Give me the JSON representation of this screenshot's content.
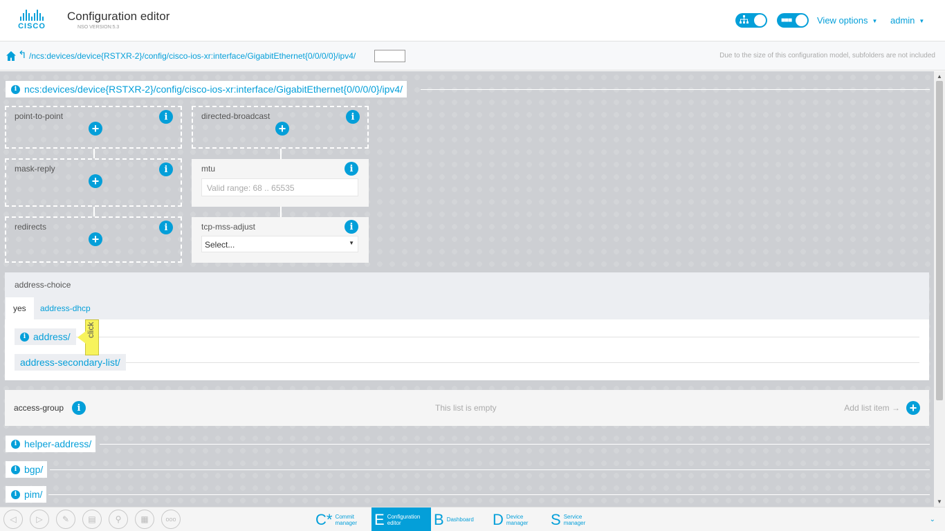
{
  "app": {
    "logo_text": "CISCO",
    "title": "Configuration editor",
    "version": "NSO VERSION:5.3",
    "view_options": "View options",
    "user": "admin"
  },
  "pathbar": {
    "path": "/ncs:devices/device{RSTXR-2}/config/cisco-ios-xr:interface/GigabitEthernet{0/0/0/0}/ipv4/",
    "input_value": "",
    "note": "Due to the size of this configuration model, subfolders are not included"
  },
  "workspace": {
    "top_crumb": "ncs:devices/device{RSTXR-2}/config/cisco-ios-xr:interface/GigabitEthernet{0/0/0/0}/ipv4/",
    "nodes": {
      "point_to_point": "point-to-point",
      "directed_broadcast": "directed-broadcast",
      "mask_reply": "mask-reply",
      "redirects": "redirects",
      "mtu": "mtu",
      "mtu_placeholder": "Valid range: 68 .. 65535",
      "tcp_mss_adjust": "tcp-mss-adjust",
      "tcp_select_value": "Select..."
    },
    "address_choice": {
      "title": "address-choice",
      "tabs": [
        "yes",
        "address-dhcp"
      ],
      "active_tab": "yes",
      "rows": [
        "address/",
        "address-secondary-list/"
      ]
    },
    "tooltip": "click",
    "access_group": {
      "title": "access-group",
      "empty_text": "This list is empty",
      "add_text": "Add list item"
    },
    "folders": [
      "helper-address/",
      "bgp/",
      "pim/"
    ]
  },
  "footer": {
    "apps": [
      {
        "letter": "C*",
        "label1": "Commit",
        "label2": "manager"
      },
      {
        "letter": "E",
        "label1": "Configuration",
        "label2": "editor"
      },
      {
        "letter": "B",
        "label1": "Dashboard",
        "label2": ""
      },
      {
        "letter": "D",
        "label1": "Device",
        "label2": "manager"
      },
      {
        "letter": "S",
        "label1": "Service",
        "label2": "manager"
      }
    ],
    "active_app": "Configuration editor"
  },
  "colors": {
    "accent": "#049fd9",
    "workspace": "#cdcfd3",
    "tooltip": "#f7f35c"
  }
}
